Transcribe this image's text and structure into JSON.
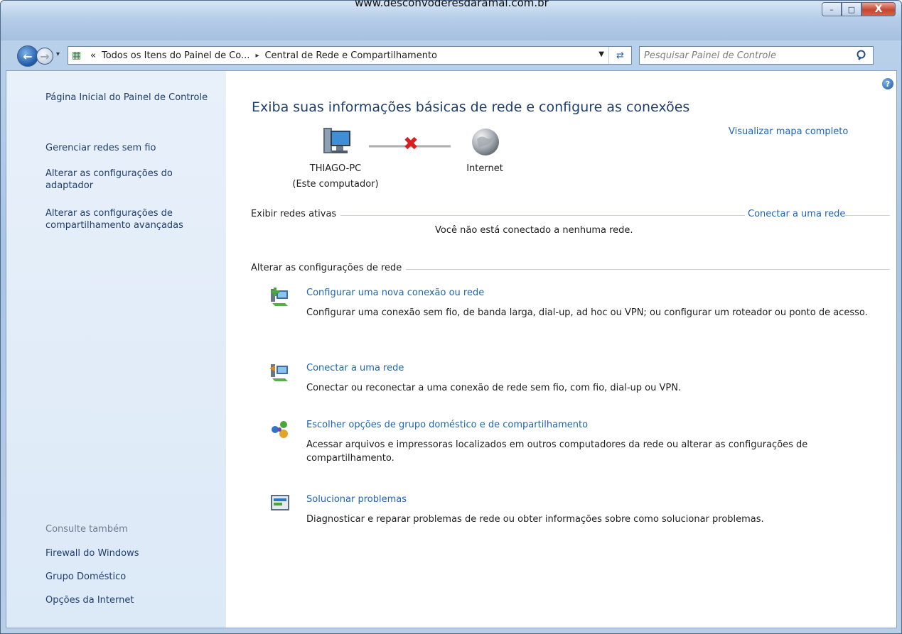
{
  "watermark": "www.desconvoderesdaramal.com.br",
  "window": {
    "minimize_label": "–",
    "maximize_label": "□",
    "close_label": "X"
  },
  "address": {
    "chevron": "«",
    "crumbs": [
      "Todos os Itens do Painel de Co...",
      "Central de Rede e Compartilhamento"
    ],
    "separator": "▸"
  },
  "search": {
    "placeholder": "Pesquisar Painel de Controle"
  },
  "sidebar": {
    "links": [
      "Página Inicial do Painel de Controle",
      "Gerenciar redes sem fio",
      "Alterar as configurações do adaptador",
      "Alterar as configurações de compartilhamento avançadas"
    ],
    "see_also_label": "Consulte também",
    "see_also": [
      "Firewall do Windows",
      "Grupo Doméstico",
      "Opções da Internet"
    ]
  },
  "main": {
    "title": "Exiba suas informações básicas de rede e configure as conexões",
    "view_map": "Visualizar mapa completo",
    "computer_name": "THIAGO-PC",
    "computer_sub": "(Este computador)",
    "internet_label": "Internet",
    "active_section": "Exibir redes ativas",
    "connect_link": "Conectar a uma rede",
    "no_network": "Você não está conectado a nenhuma rede.",
    "change_section": "Alterar as configurações de rede",
    "tasks": [
      {
        "title": "Configurar uma nova conexão ou rede",
        "desc": "Configurar uma conexão sem fio, de banda larga, dial-up, ad hoc ou VPN; ou configurar um roteador ou ponto de acesso.",
        "icon": "new-connection-icon"
      },
      {
        "title": "Conectar a uma rede",
        "desc": "Conectar ou reconectar a uma conexão de rede sem fio, com fio, dial-up ou VPN.",
        "icon": "connect-network-icon"
      },
      {
        "title": "Escolher opções de grupo doméstico e de compartilhamento",
        "desc": "Acessar arquivos e impressoras localizados em outros computadores da rede ou alterar as configurações de compartilhamento.",
        "icon": "homegroup-icon"
      },
      {
        "title": "Solucionar problemas",
        "desc": "Diagnosticar e reparar problemas de rede ou obter informações sobre como solucionar problemas.",
        "icon": "troubleshoot-icon"
      }
    ]
  },
  "colors": {
    "link": "#1e64b4",
    "heading": "#1e3f6c",
    "sidebar_bg": "#dce9f7"
  }
}
